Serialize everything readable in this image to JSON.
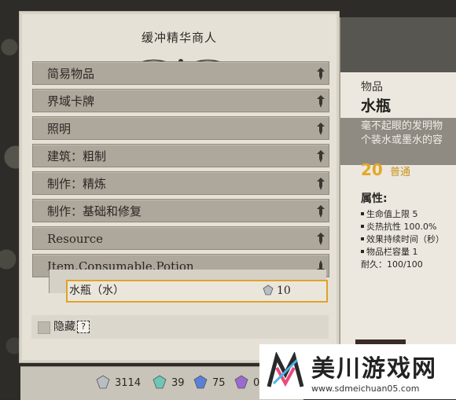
{
  "merchant": {
    "title": "缓冲精华商人",
    "categories": [
      {
        "label": "简易物品",
        "expanded": false
      },
      {
        "label": "界域卡牌",
        "expanded": false
      },
      {
        "label": "照明",
        "expanded": false
      },
      {
        "label": "建筑：粗制",
        "expanded": false
      },
      {
        "label": "制作：精炼",
        "expanded": false
      },
      {
        "label": "制作：基础和修复",
        "expanded": false
      },
      {
        "label": "Resource",
        "expanded": false
      },
      {
        "label": "Item.Consumable.Potion",
        "expanded": true
      }
    ],
    "selected_item": {
      "name": "水瓶（水）",
      "price": "10",
      "price_icon": "silver-gem-icon"
    },
    "hide_label": "隐藏",
    "help_glyph": "?"
  },
  "currency": [
    {
      "value": "3114",
      "icon": "silver-gem-icon",
      "color": "#b8bec4"
    },
    {
      "value": "39",
      "icon": "teal-gem-icon",
      "color": "#6fc6b8"
    },
    {
      "value": "75",
      "icon": "blue-gem-icon",
      "color": "#5b7fd6"
    },
    {
      "value": "0",
      "icon": "purple-gem-icon",
      "color": "#9b6ad0"
    }
  ],
  "detail": {
    "category": "物品",
    "name": "水瓶",
    "description_lines": [
      "毫不起眼的发明物",
      "个装水或墨水的容"
    ],
    "price": "20",
    "quality": "普通",
    "attributes_title": "属性:",
    "attributes": [
      {
        "text": "生命值上限  5",
        "bullet": true
      },
      {
        "text": "炎热抗性  100.0%",
        "bullet": true
      },
      {
        "text": "效果持续时间（秒）",
        "bullet": true
      },
      {
        "text": "物品栏容量  1",
        "bullet": true
      },
      {
        "text": "耐久：100/100",
        "bullet": false
      }
    ]
  },
  "watermark": {
    "text": "美川游戏网",
    "url": "www.sdmeichuan05.com"
  },
  "colors": {
    "accent": "#e0a22a",
    "category_bar": "#ada79c",
    "panel": "#e6e1d7"
  }
}
